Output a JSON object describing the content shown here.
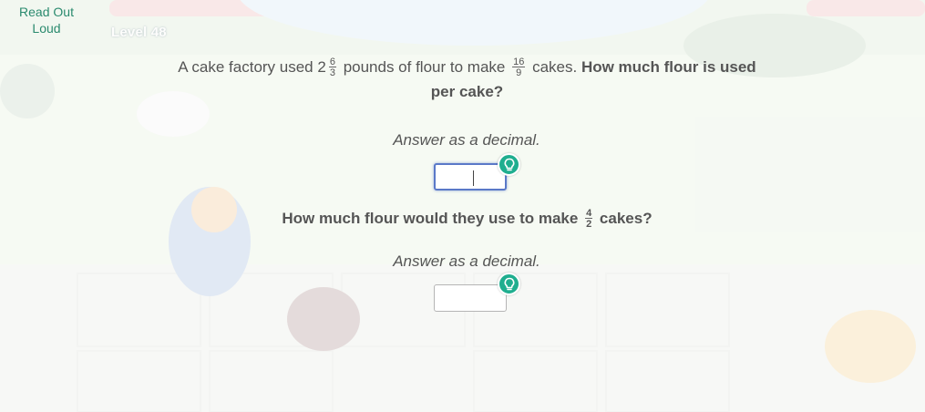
{
  "toolbar": {
    "read_out_loud": "Read Out Loud"
  },
  "level": {
    "label": "Level 48"
  },
  "question1": {
    "text_before": "A cake factory used 2",
    "mixed_fraction": {
      "num": "6",
      "den": "3"
    },
    "text_middle": "pounds of flour to make",
    "fraction": {
      "num": "16",
      "den": "9"
    },
    "text_after": "cakes.",
    "bold_text": "How much flour is used per cake?"
  },
  "answer1": {
    "hint": "Answer as a decimal.",
    "value": ""
  },
  "question2": {
    "text_before": "How much flour would they use to make",
    "fraction": {
      "num": "4",
      "den": "2"
    },
    "text_after": "cakes?"
  },
  "answer2": {
    "hint": "Answer as a decimal.",
    "value": ""
  },
  "icons": {
    "hint_button": "lightbulb-icon"
  },
  "colors": {
    "accent": "#1fae8f",
    "read_out_text": "#2a8a6e",
    "focus_border": "#5a79c8"
  }
}
